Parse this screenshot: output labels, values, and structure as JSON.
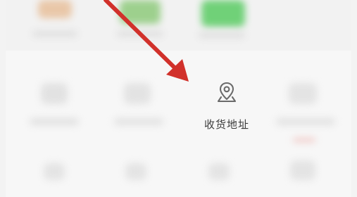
{
  "menu": {
    "shipping_address": {
      "label": "收货地址",
      "icon": "location-pin-icon"
    }
  },
  "colors": {
    "annotation_arrow": "#d1312b",
    "icon_stroke": "#6b6b6b",
    "label_text": "#3b3b3b"
  }
}
